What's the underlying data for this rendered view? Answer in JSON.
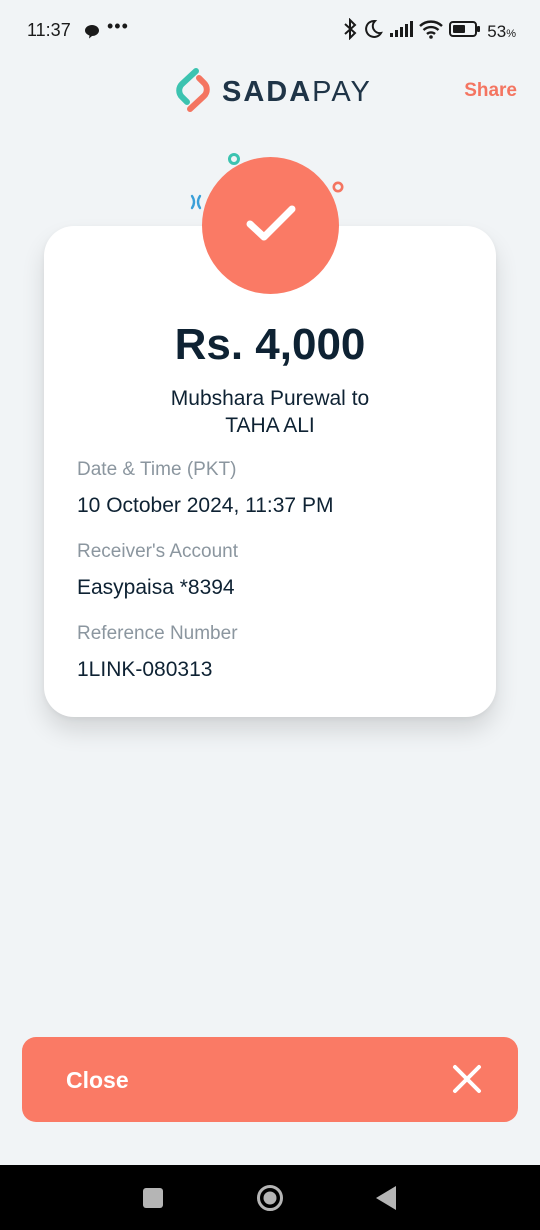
{
  "status_bar": {
    "time": "11:37",
    "dots": "•••",
    "battery": "53",
    "battery_unit": "%"
  },
  "header": {
    "logo_sada": "SADA",
    "logo_pay": "PAY",
    "share_label": "Share"
  },
  "receipt": {
    "amount": "Rs. 4,000",
    "sender": "Mubshara Purewal",
    "connector": "to",
    "receiver": "TAHA ALI",
    "details": [
      {
        "label": "Date & Time (PKT)",
        "value": "10 October 2024, 11:37 PM"
      },
      {
        "label": "Receiver's Account",
        "value": "Easypaisa *8394"
      },
      {
        "label": "Reference Number",
        "value": "1LINK-080313"
      }
    ]
  },
  "close_button": {
    "label": "Close"
  },
  "colors": {
    "accent": "#fa7a65",
    "brand_teal": "#3cc3b0",
    "text_dark": "#0e2233",
    "label_gray": "#8b969f",
    "background": "#f1f4f6"
  },
  "icons": [
    "chat-bubble-icon",
    "bluetooth-icon",
    "moon-icon",
    "signal-icon",
    "wifi-icon",
    "battery-icon",
    "sadapay-logo-icon",
    "checkmark-icon",
    "close-icon",
    "nav-recents-icon",
    "nav-home-icon",
    "nav-back-icon"
  ]
}
